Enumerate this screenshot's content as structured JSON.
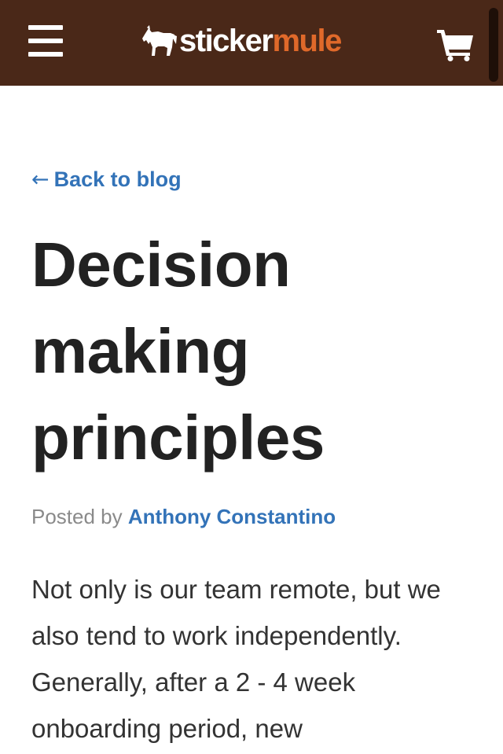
{
  "header": {
    "logo": {
      "word1": "sticker",
      "word2": "mule"
    },
    "menu_icon": "hamburger-menu-icon",
    "cart_icon": "shopping-cart-icon"
  },
  "article": {
    "back_arrow": "←",
    "back_label": "Back to blog",
    "title": "Decision making principles",
    "byline_prefix": "Posted by",
    "author": "Anthony Constantino",
    "intro": "Not only is our team remote, but we also tend to work independently. Generally, after a 2 - 4 week onboarding period, new"
  },
  "colors": {
    "header_bg": "#4a2818",
    "brand_orange": "#e0692a",
    "link_blue": "#3373b8",
    "title_text": "#222222",
    "body_text": "#333333",
    "muted_text": "#8a8a8a"
  }
}
